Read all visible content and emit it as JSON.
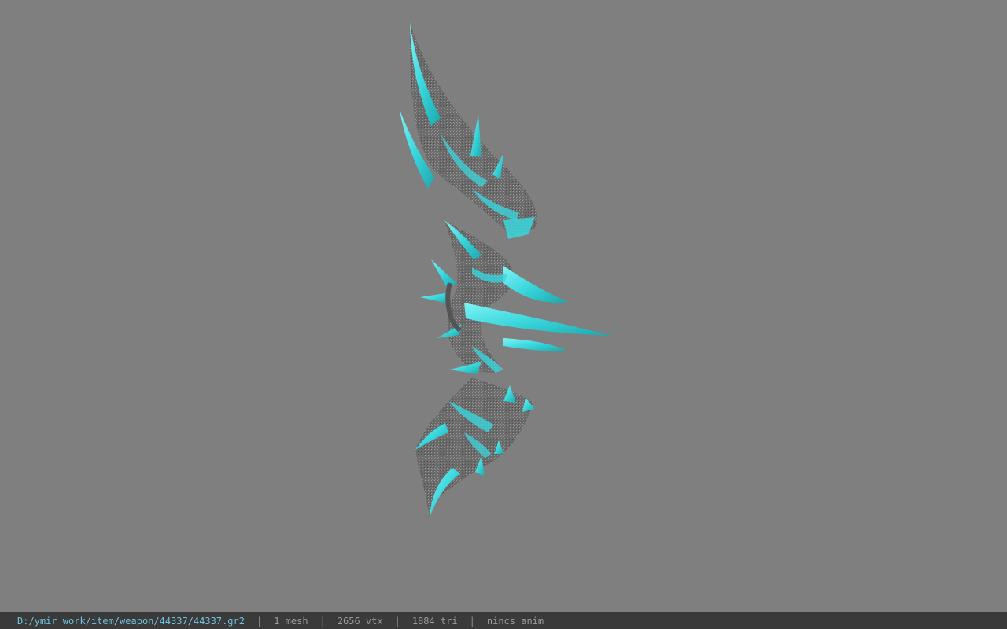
{
  "viewport": {
    "background_color": "#7f7f7f",
    "model_accent_color": "#39d6dc",
    "model_base_color": "#6a6a6a"
  },
  "status_bar": {
    "file_path": "D:/ymir work/item/weapon/44337/44337.gr2",
    "separator": "|",
    "mesh_count": "1 mesh",
    "vertex_count": "2656 vtx",
    "triangle_count": "1884 tri",
    "anim_status": "nincs anim",
    "path_color": "#6fc3e0"
  }
}
